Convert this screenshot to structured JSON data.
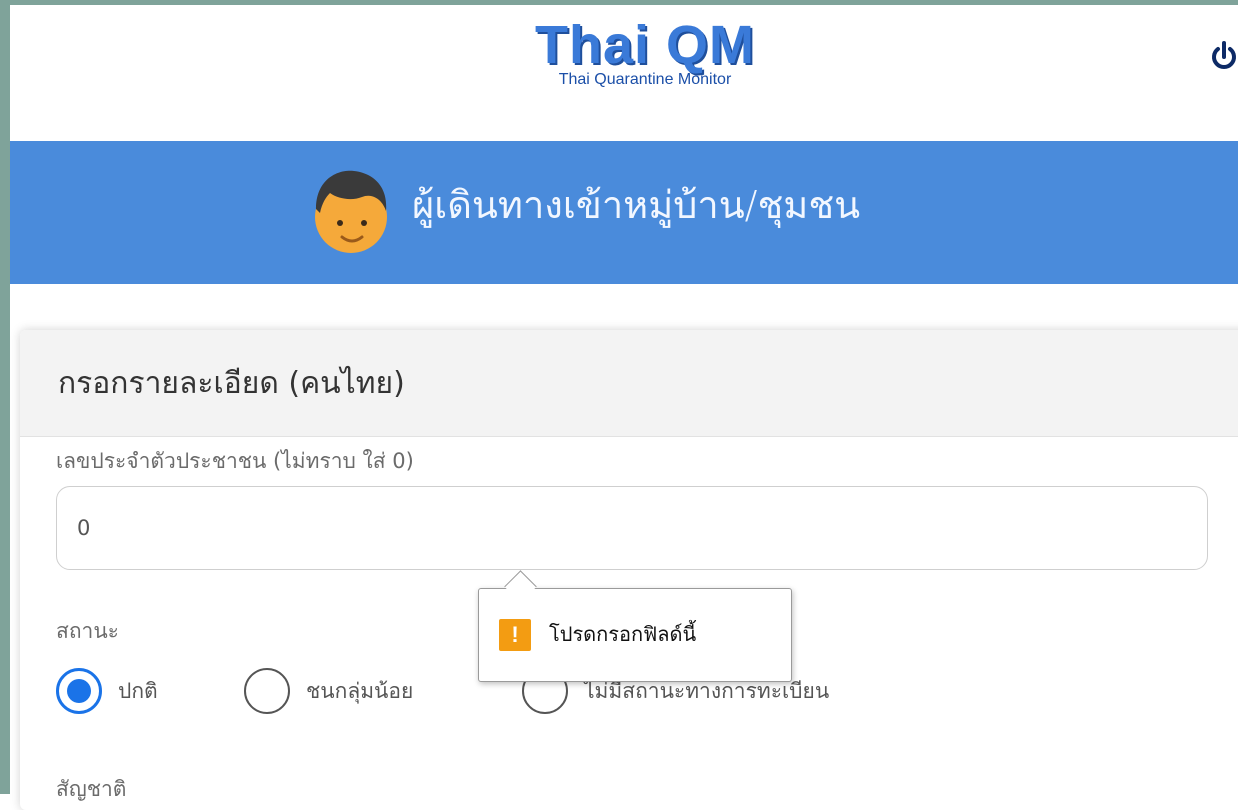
{
  "header": {
    "logo_main": "Thai QM",
    "logo_sub": "Thai Quarantine Monitor",
    "power_icon": "power-icon"
  },
  "banner": {
    "title": "ผู้เดินทางเข้าหมู่บ้าน/ชุมชน",
    "avatar_icon": "person-avatar-icon",
    "color": "#4a8bdb"
  },
  "form": {
    "section_title": "กรอกรายละเอียด (คนไทย)",
    "id_label": "เลขประจำตัวประชาชน (ไม่ทราบ ใส่ 0)",
    "id_value": "0",
    "status_label": "สถานะ",
    "status_options": [
      {
        "label": "ปกติ",
        "checked": true
      },
      {
        "label": "ชนกลุ่มน้อย",
        "checked": false
      },
      {
        "label": "ไม่มีสถานะทางการทะเบียน",
        "checked": false
      }
    ],
    "nationality_label": "สัญชาติ"
  },
  "tooltip": {
    "icon": "warning-icon",
    "text": "โปรดกรอกฟิลด์นี้",
    "icon_color": "#f39c12"
  }
}
